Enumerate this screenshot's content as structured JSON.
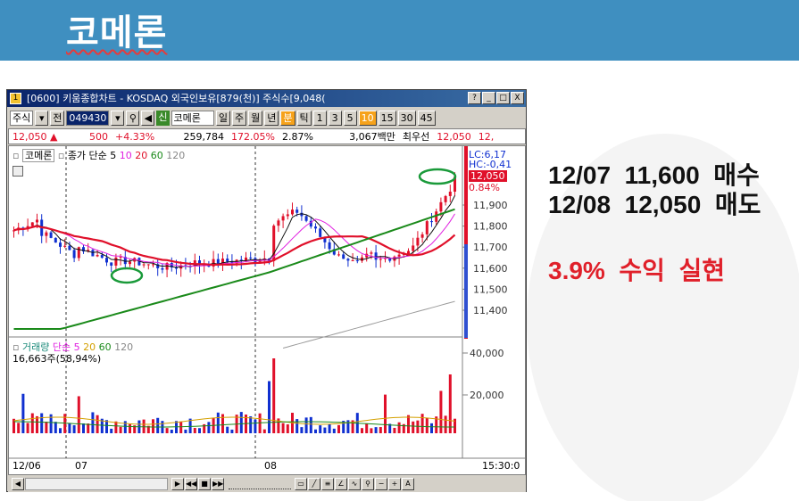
{
  "banner": {
    "title": "코메론"
  },
  "notes": {
    "line1": "12/07  11,600  매수",
    "line2": "12/08  12,050  매도",
    "result": "3.9%  수익  실현"
  },
  "window": {
    "title": "[0600] 키움종합차트 - KOSDAQ 외국인보유[879(천)] 주식수[9,048(",
    "icon": "1",
    "buttons": [
      "?",
      "_",
      "□",
      "X"
    ]
  },
  "toolbar": {
    "market": "주식",
    "prev_label": "전",
    "code": "049430",
    "new_badge": "신",
    "stock_name": "코메론",
    "periods": [
      "일",
      "주",
      "월",
      "년"
    ],
    "minute": "분",
    "tick": "틱",
    "intervals": [
      "1",
      "3",
      "5",
      "10",
      "15",
      "30",
      "45"
    ],
    "selected_interval": "10"
  },
  "quote": {
    "price": "12,050 ▲",
    "change": "500",
    "change_pct": "+4.33%",
    "volume": "259,784",
    "vol_ratio": "172.05%",
    "turnover": "2.87%",
    "amount": "3,067백만",
    "best_label": "최우선",
    "best_price": "12,050",
    "extra": "12,"
  },
  "price_legend": {
    "name": "코메론",
    "ma_label": "종가 단순 5",
    "ma": [
      "10",
      "20",
      "60",
      "120"
    ]
  },
  "price_axis": {
    "lc": "LC:6,17",
    "hc": "HC:-0,41",
    "current": "12,050",
    "pct": "0.84%",
    "ticks": [
      "11,900",
      "11,800",
      "11,700",
      "11,600",
      "11,500",
      "11,400"
    ]
  },
  "volume_legend": {
    "name": "거래량",
    "ma_label": "단순 5",
    "ma": [
      "20",
      "60",
      "120"
    ],
    "value": "16,663주(58,94%)"
  },
  "volume_axis": {
    "ticks": [
      "40,000",
      "20,000"
    ]
  },
  "time_axis": {
    "labels": [
      "12/06",
      "07",
      "08",
      "15:30:0"
    ]
  },
  "colors": {
    "up": "#e0102a",
    "down": "#1030d0",
    "ma5": "#111111",
    "ma10": "#e020e0",
    "ma20": "#e0102a",
    "ma60": "#1a8a1a",
    "ma120": "#9a9a9a",
    "banner": "#3f8fc0"
  }
}
